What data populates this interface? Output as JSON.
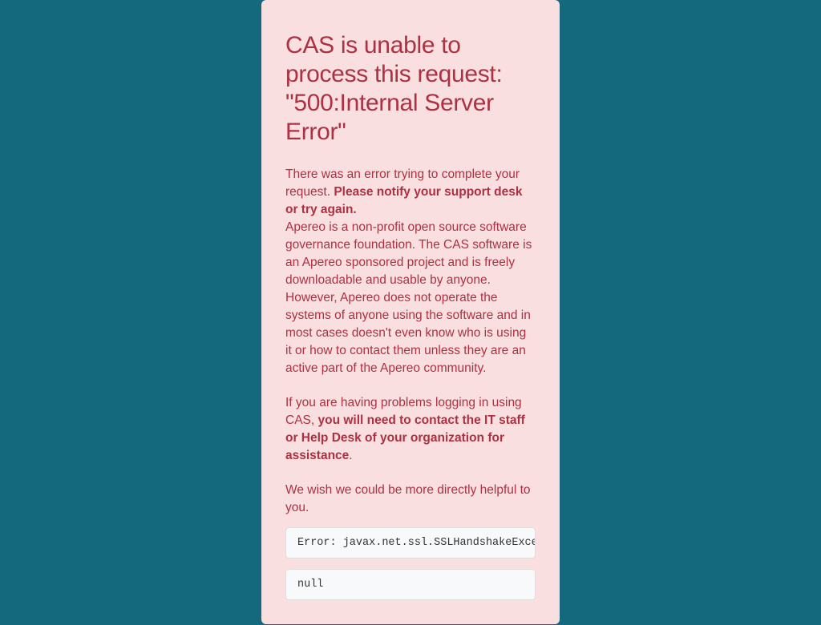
{
  "heading": "CAS is unable to process this request: \"500:Internal Server Error\"",
  "para1": {
    "lead": "There was an error trying to complete your request. ",
    "bold": "Please notify your support desk or try again."
  },
  "para2": "Apereo is a non-profit open source software governance foundation. The CAS software is an Apereo sponsored project and is freely downloadable and usable by anyone. However, Apereo does not operate the systems of anyone using the software and in most cases doesn't even know who is using it or how to contact them unless they are an active part of the Apereo community.",
  "para3": {
    "lead": "If you are having problems logging in using CAS, ",
    "bold": "you will need to contact the IT staff or Help Desk of your organization for assistance",
    "tail": "."
  },
  "para4": "We wish we could be more directly helpful to you.",
  "error_line": "Error: javax.net.ssl.SSLHandshakeException",
  "null_line": "null"
}
